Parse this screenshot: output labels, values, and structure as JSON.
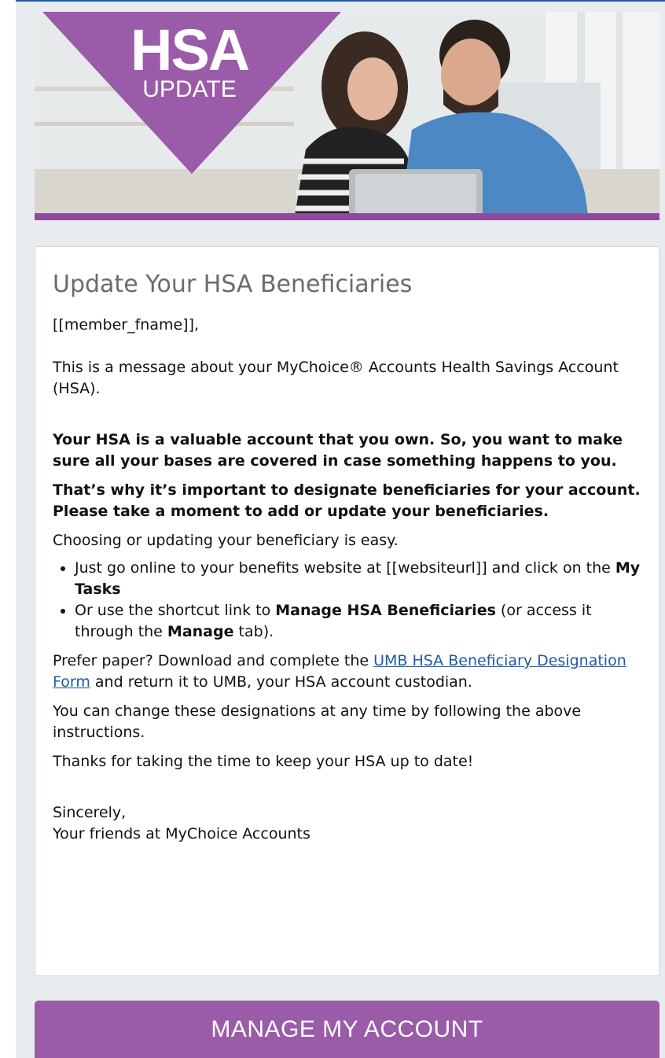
{
  "hero": {
    "badge_title": "HSA",
    "badge_subtitle": "UPDATE",
    "image": "couple-with-tablet-photo",
    "accent_color": "#9a5ba8",
    "strip_color": "#8e4c9e"
  },
  "card": {
    "title": "Update Your HSA Beneficiaries",
    "greeting": "[[member_fname]],",
    "intro": "This is a message about your MyChoice® Accounts Health Savings Account (HSA).",
    "bold_1": "Your HSA is a valuable account that you own. So, you want to make sure all your bases are covered in case something happens to you.",
    "bold_2": "That’s why it’s important to designate beneficiaries for your account. Please take a moment to add or update your beneficiaries.",
    "easy": "Choosing or updating your beneficiary is easy.",
    "bullet_1": {
      "pre": "Just go online to your benefits website at [[websiteurl]] and click on the ",
      "strong": "My Tasks"
    },
    "bullet_2": {
      "pre": "Or use the shortcut link to ",
      "strong_1": "Manage HSA Beneficiaries",
      "mid": " (or access it through the ",
      "strong_2": "Manage",
      "post": " tab)."
    },
    "paper": {
      "pre": "Prefer paper? Download and complete the ",
      "link": "UMB HSA Beneficiary Designation Form",
      "post": " and return it to UMB, your HSA account custodian."
    },
    "change": "You can change these designations at any time by following the above instructions.",
    "thanks": "Thanks for taking the time to keep your HSA up to date!",
    "signoff": "Sincerely,",
    "signature": "Your friends at MyChoice Accounts",
    "link_color": "#1f5aa6"
  },
  "cta": {
    "label": "MANAGE MY ACCOUNT",
    "color": "#9a5ba8"
  }
}
